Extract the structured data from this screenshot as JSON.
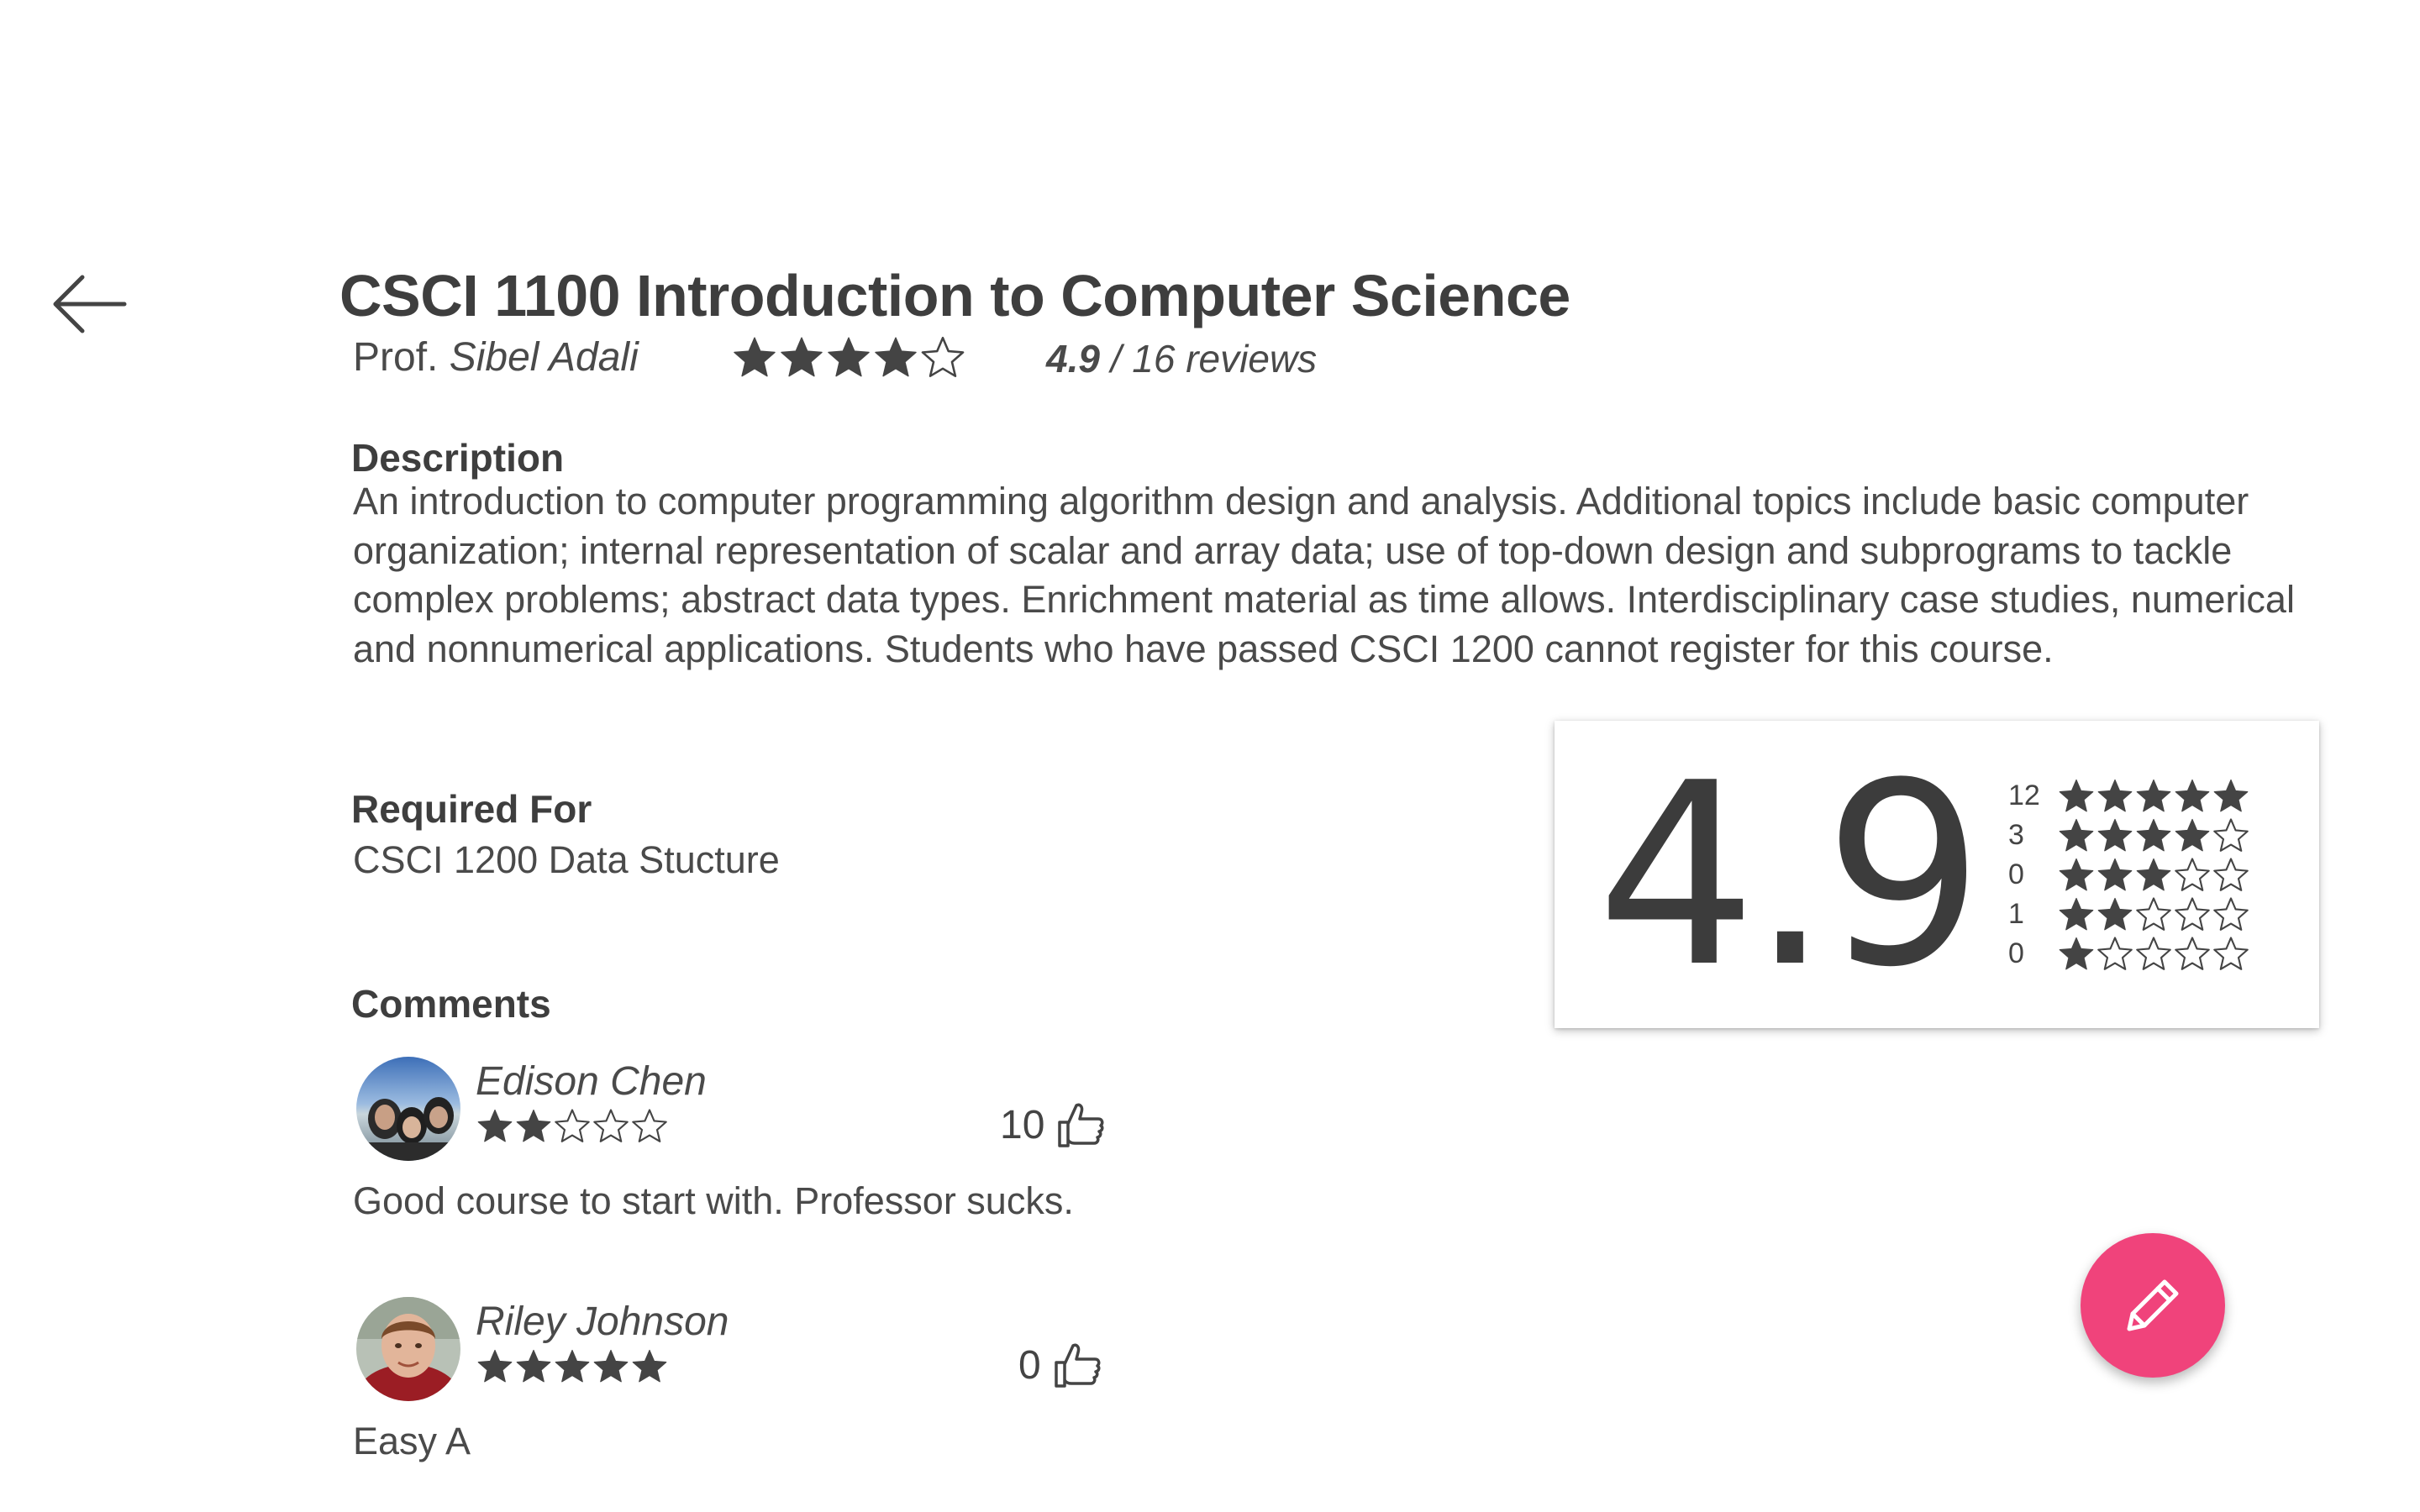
{
  "header": {
    "course_title": "CSCI 1100 Introduction to Computer Science",
    "prof_prefix": "Prof.",
    "prof_name": "Sibel Adali",
    "star_rating": 4,
    "rating_value": "4.9",
    "rating_suffix": "/ 16 reviews"
  },
  "description": {
    "label": "Description",
    "text": "An introduction to computer programming algorithm design and analysis. Additional topics include basic computer organization; internal representation of scalar and array data; use of top-down design and subprograms to tackle complex problems; abstract data types. Enrichment material as time allows. Interdisciplinary case studies, numerical and nonnumerical applications. Students who have passed CSCI 1200 cannot register for this course."
  },
  "required_for": {
    "label": "Required For",
    "text": "CSCI 1200 Data Stucture"
  },
  "rating_card": {
    "big_value": "4.9",
    "distribution": [
      {
        "count": "12",
        "stars": 5
      },
      {
        "count": "3",
        "stars": 4
      },
      {
        "count": "0",
        "stars": 3
      },
      {
        "count": "1",
        "stars": 2
      },
      {
        "count": "0",
        "stars": 1
      }
    ]
  },
  "comments": {
    "label": "Comments",
    "items": [
      {
        "name": "Edison Chen",
        "stars": 2,
        "likes": "10",
        "text": "Good course to start with. Professor sucks."
      },
      {
        "name": "Riley Johnson",
        "stars": 5,
        "likes": "0",
        "text": "Easy A"
      }
    ]
  },
  "icons": {
    "back": "arrow-left-icon",
    "thumb": "thumbs-up-icon",
    "fab": "pencil-icon"
  },
  "colors": {
    "text": "#444444",
    "star": "#444444",
    "fab": "#f0437b"
  }
}
